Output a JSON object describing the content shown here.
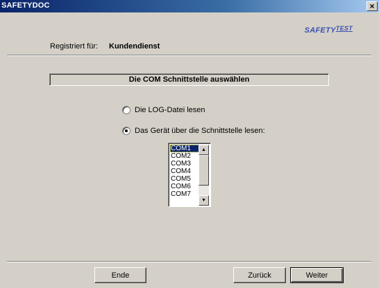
{
  "window": {
    "title": "SAFETYDOC",
    "close_label": "×"
  },
  "brand": {
    "main": "SAFETY",
    "sup": "TEST"
  },
  "registration": {
    "label": "Registriert für:",
    "value": "Kundendienst"
  },
  "section": {
    "heading": "Die COM Schnittstelle auswählen"
  },
  "options": [
    {
      "label": "Die LOG-Datei lesen",
      "checked": false
    },
    {
      "label": "Das Gerät über die Schnittstelle lesen:",
      "checked": true
    }
  ],
  "ports": {
    "items": [
      "COM1",
      "COM2",
      "COM3",
      "COM4",
      "COM5",
      "COM6",
      "COM7"
    ],
    "selected": "COM1"
  },
  "scrollbar": {
    "up": "▲",
    "down": "▼"
  },
  "buttons": {
    "end": "Ende",
    "back": "Zurück",
    "next": "Weiter"
  }
}
